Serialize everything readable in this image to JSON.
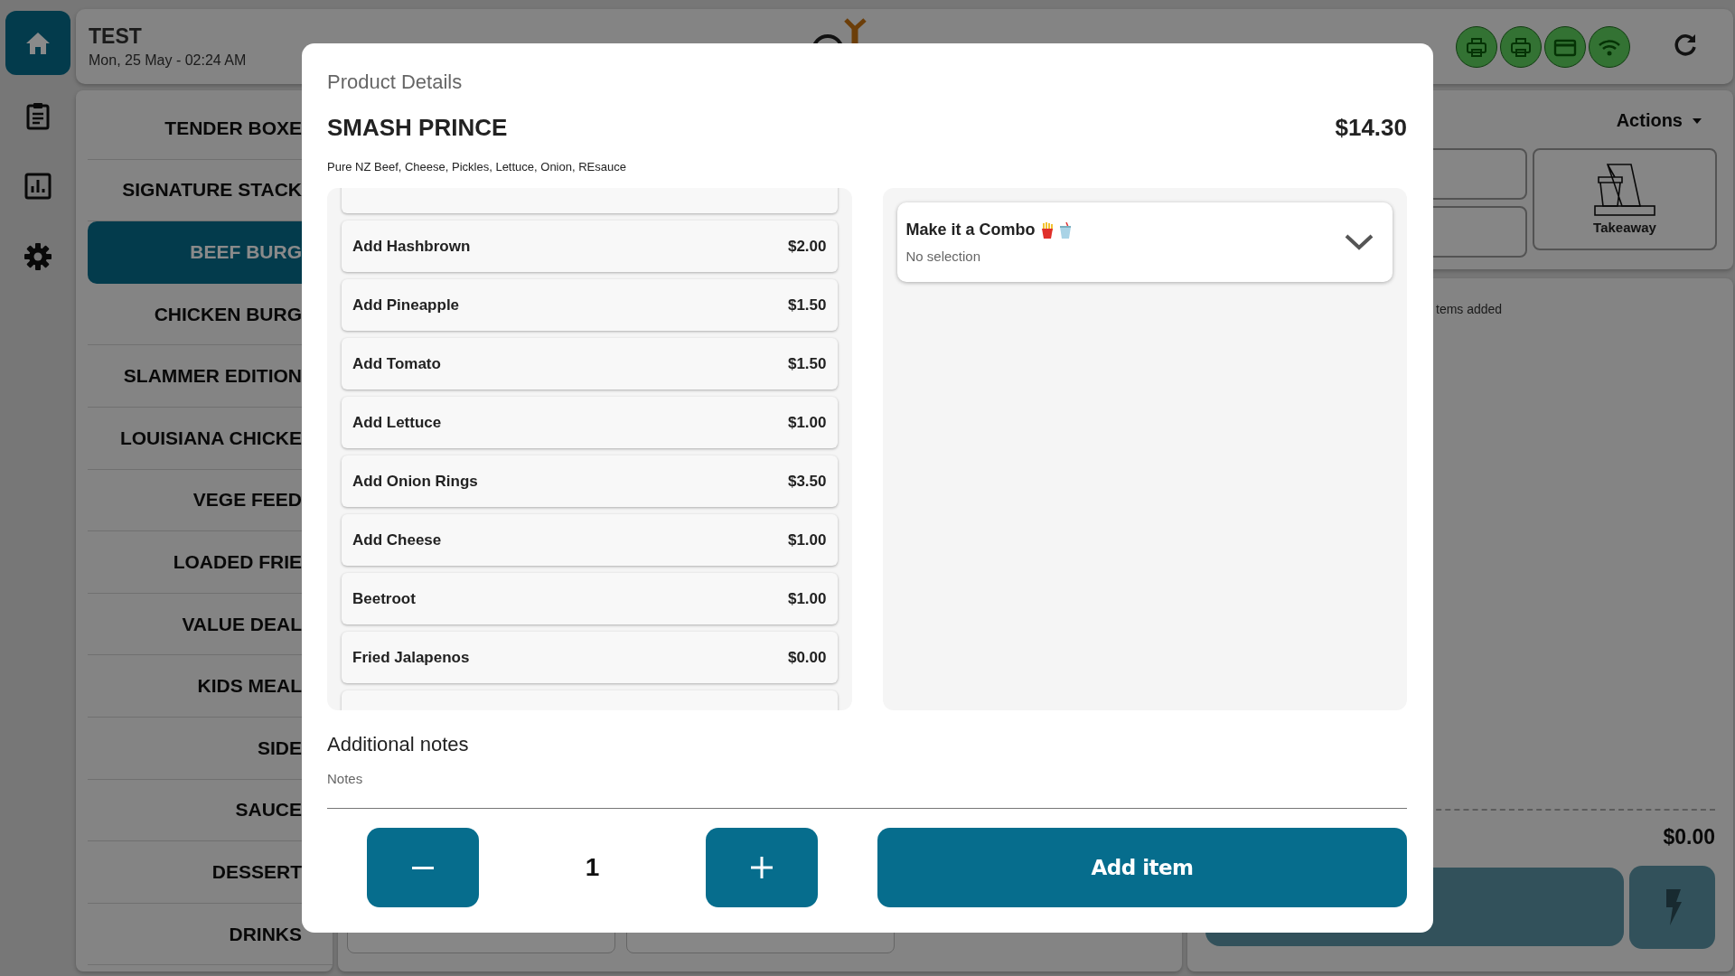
{
  "rail": {
    "items": [
      {
        "kind": "home",
        "selected": true
      },
      {
        "kind": "orders",
        "selected": false
      },
      {
        "kind": "reports",
        "selected": false
      },
      {
        "kind": "settings",
        "selected": false
      }
    ]
  },
  "header": {
    "title": "TEST",
    "datetime": "Mon, 25 May - 02:24 AM",
    "status_icons": [
      {
        "kind": "printer"
      },
      {
        "kind": "printer"
      },
      {
        "kind": "card"
      },
      {
        "kind": "wifi"
      }
    ]
  },
  "categories": [
    {
      "label": "TENDER BOXE",
      "selected": false
    },
    {
      "label": "SIGNATURE STACK",
      "selected": false
    },
    {
      "label": "BEEF BURG",
      "selected": true
    },
    {
      "label": "CHICKEN BURG",
      "selected": false
    },
    {
      "label": "SLAMMER EDITION",
      "selected": false
    },
    {
      "label": "LOUISIANA CHICKE",
      "selected": false
    },
    {
      "label": "VEGE FEED",
      "selected": false
    },
    {
      "label": "LOADED FRIE",
      "selected": false
    },
    {
      "label": "VALUE DEAL",
      "selected": false
    },
    {
      "label": "KIDS MEAL",
      "selected": false
    },
    {
      "label": "SIDE",
      "selected": false
    },
    {
      "label": "SAUCE",
      "selected": false
    },
    {
      "label": "DESSERT",
      "selected": false
    },
    {
      "label": "DRINKS",
      "selected": false
    }
  ],
  "order": {
    "actions_label": "Actions",
    "order_type": "Takeaway",
    "empty_message": "tems added",
    "total": "$0.00"
  },
  "modal": {
    "heading": "Product Details",
    "name": "SMASH PRINCE",
    "price": "$14.30",
    "description": "Pure NZ Beef, Cheese, Pickles, Lettuce, Onion, REsauce",
    "options": [
      {
        "name": "Add Hashbrown",
        "price": "$2.00"
      },
      {
        "name": "Add Pineapple",
        "price": "$1.50"
      },
      {
        "name": "Add Tomato",
        "price": "$1.50"
      },
      {
        "name": "Add Lettuce",
        "price": "$1.00"
      },
      {
        "name": "Add Onion Rings",
        "price": "$3.50"
      },
      {
        "name": "Add Cheese",
        "price": "$1.00"
      },
      {
        "name": "Beetroot",
        "price": "$1.00"
      },
      {
        "name": "Fried Jalapenos",
        "price": "$0.00"
      }
    ],
    "modifier_groups": [
      {
        "title": "Make it a Combo",
        "selection": "No selection",
        "expanded": false
      }
    ],
    "notes_heading": "Additional notes",
    "notes": {
      "placeholder": "Notes"
    },
    "quantity": "1",
    "add_button": "Add item"
  }
}
